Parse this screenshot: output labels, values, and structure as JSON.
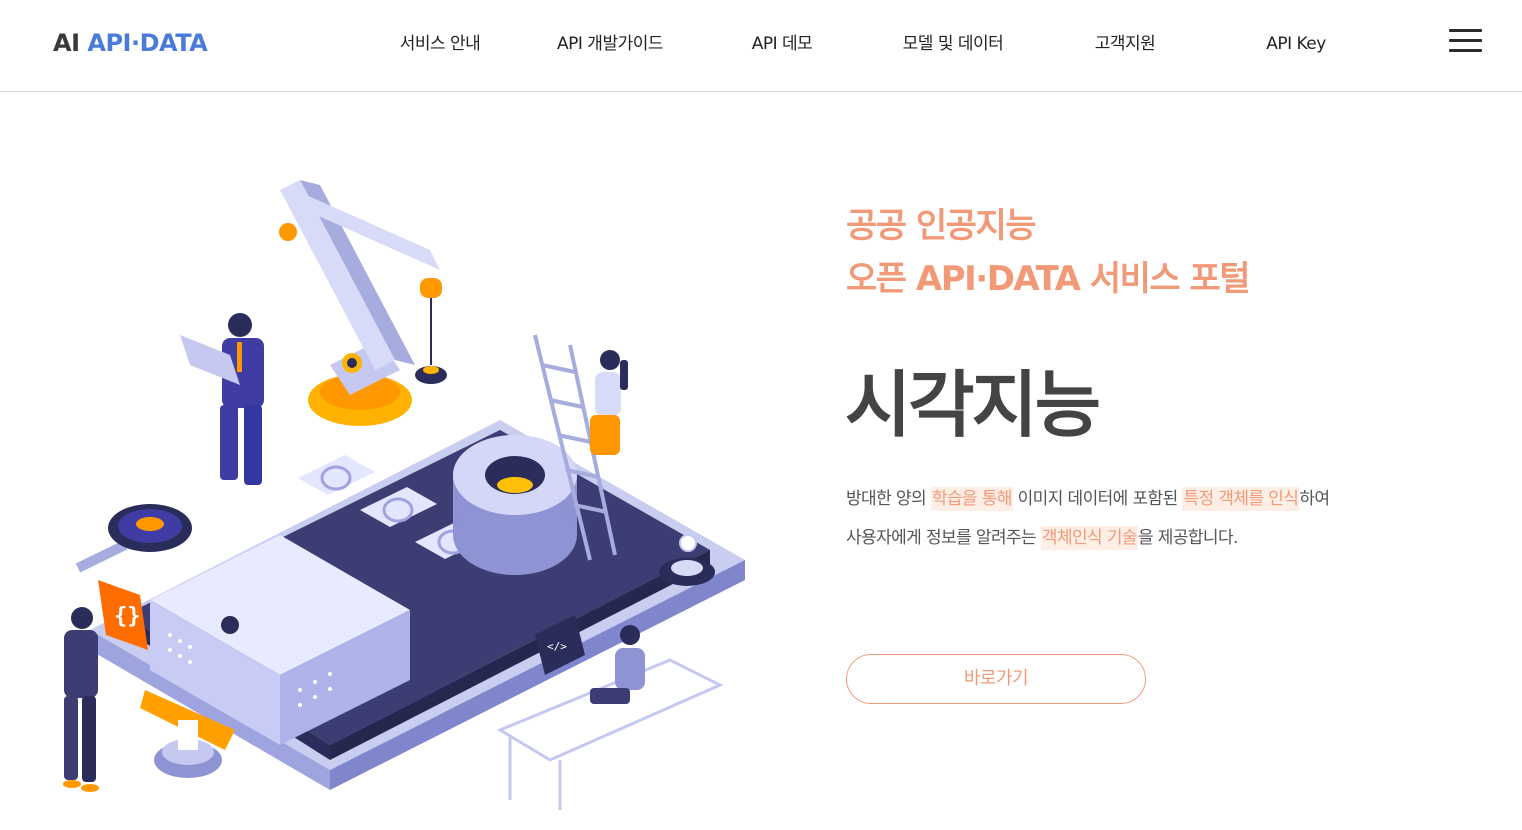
{
  "colors": {
    "accent": "#f29a78",
    "brand_blue": "#4a7bd9",
    "title_gray": "#444444",
    "highlight_bg": "#fdeee6"
  },
  "header": {
    "logo_ai": "AI",
    "logo_brand": "API·DATA",
    "nav": [
      {
        "label": "서비스 안내"
      },
      {
        "label": "API 개발가이드"
      },
      {
        "label": "API 데모"
      },
      {
        "label": "모델 및 데이터"
      },
      {
        "label": "고객지원"
      },
      {
        "label": "API Key"
      }
    ],
    "menu_icon": "hamburger-menu-icon"
  },
  "hero": {
    "subtitle_line1": "공공 인공지능",
    "subtitle_line2": "오픈 API·DATA 서비스 포털",
    "title": "시각지능",
    "desc_line1": [
      {
        "text": "방대한 양의 ",
        "hl": false
      },
      {
        "text": "학습을 통해",
        "hl": true
      },
      {
        "text": " 이미지 데이터에 포함된 ",
        "hl": false
      },
      {
        "text": "특정 객체를 인식",
        "hl": true
      },
      {
        "text": "하여",
        "hl": false
      }
    ],
    "desc_line2": [
      {
        "text": "사용자에게 정보를 알려주는 ",
        "hl": false
      },
      {
        "text": "객체인식 기술",
        "hl": true
      },
      {
        "text": "을 제공합니다.",
        "hl": false
      }
    ],
    "button_label": "바로가기"
  },
  "illustration": {
    "icons": [
      "robot-arm-icon",
      "smartphone-icon",
      "gear-icon",
      "ladder-icon",
      "laptop-code-icon",
      "curly-braces-icon",
      "magnifier-icon"
    ]
  }
}
